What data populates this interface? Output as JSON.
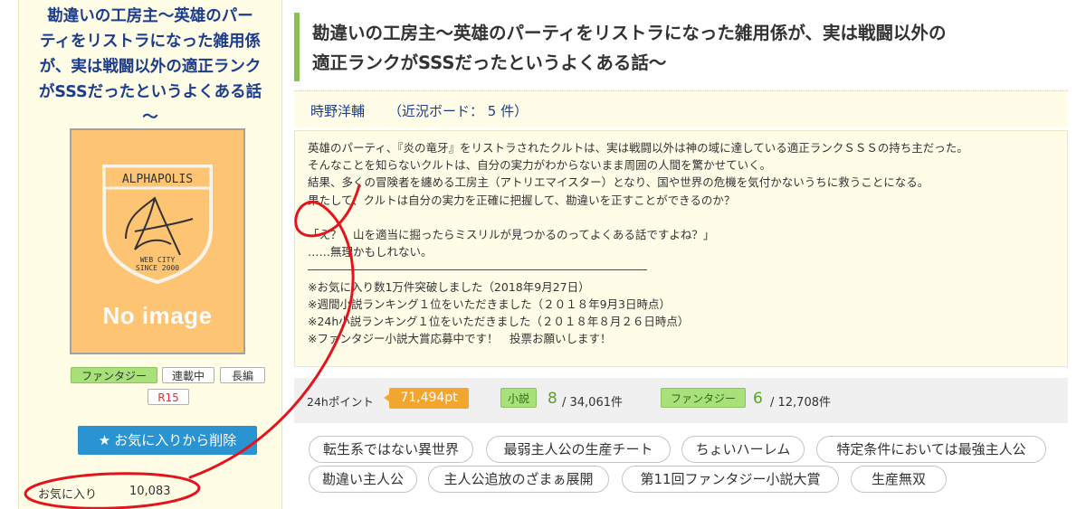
{
  "novel": {
    "title": "勘違いの工房主〜英雄のパーティをリストラになった雑用係が、実は戦闘以外の適正ランクがSSSだったというよくある話〜",
    "title_lines": [
      "勘違いの工房主〜英雄のパーティをリストラになった雑用係が、実は戦闘以外の",
      "適正ランクがSSSだったというよくある話〜"
    ],
    "author": "時野洋輔",
    "board": "（近況ボード： 5 件）"
  },
  "sidebar": {
    "title_lines": [
      "勘違いの工房主〜英雄のパー",
      "ティをリストラになった雑用係",
      "が、実は戦闘以外の適正ランク",
      "がSSSだったというよくある話",
      "〜"
    ],
    "cover": {
      "logo_text": "ALPHAPOLIS",
      "badge_line1": "WEB CITY",
      "badge_line2": "SINCE 2000",
      "no_image": "No image"
    },
    "tags": {
      "genre": "ファンタジー",
      "status": "連載中",
      "length": "長編",
      "rating": "R15"
    },
    "favorite_button": {
      "icon": "star-icon",
      "label": "お気に入りから削除"
    },
    "favorites": {
      "label": "お気に入り",
      "count": "10,083"
    }
  },
  "synopsis_lines": [
    "英雄のパーティ、『炎の竜牙』をリストラされたクルトは、実は戦闘以外は神の域に達している適正ランクＳＳＳの持ち主だった。",
    "そんなことを知らないクルトは、自分の実力がわからないまま周囲の人間を驚かせていく。",
    "結果、多くの冒険者を纏める工房主（アトリエマイスター）となり、国や世界の危機を気付かないうちに救うことになる。",
    "果たして、クルトは自分の実力を正確に把握して、勘違いを正すことができるのか？",
    "",
    "「え？　山を適当に掘ったらミスリルが見つかるのってよくある話ですよね？」",
    "……無理かもしれない。",
    "――――――――――――――――――――――――――――――",
    "※お気に入り数1万件突破しました（2018年9月27日）",
    "※週間小説ランキング１位をいただきました（２０１８年9月3日時点）",
    "※24h小説ランキング１位をいただきました（２０１８年８月２６日時点）",
    "※ファンタジー小説大賞応募中です！　投票お願いします！"
  ],
  "ranking": {
    "label_24h": "24hポイント",
    "points": "71,494pt",
    "novel_label": "小説",
    "novel_rank": "8",
    "novel_total": "/ 34,061件",
    "genre_label": "ファンタジー",
    "genre_rank": "6",
    "genre_total": "/ 12,708件"
  },
  "keywords": [
    "転生系ではない異世界",
    "最弱主人公の生産チート",
    "ちょいハーレム",
    "特定条件においては最強主人公",
    "勘違い主人公",
    "主人公追放のざまぁ展開",
    "第11回ファンタジー小説大賞",
    "生産無双"
  ],
  "colors": {
    "title_accent": "#8cc151",
    "link_blue": "#1c3d8c",
    "button_blue": "#2a93d2",
    "points_orange": "#f3a62e",
    "genre_green": "#a8e07a",
    "annotation_red": "#e3141c"
  }
}
